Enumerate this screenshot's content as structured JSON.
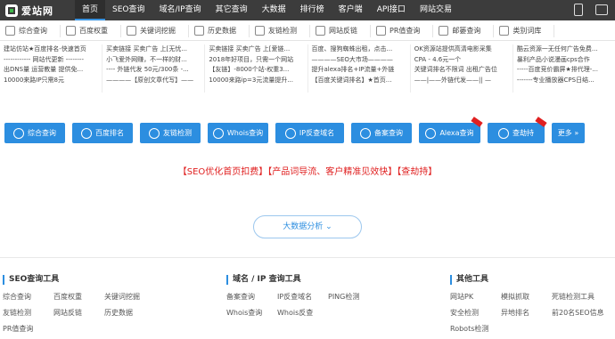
{
  "header": {
    "logo_text": "爱站网",
    "nav": [
      "首页",
      "SEO查询",
      "域名/IP查询",
      "其它查询",
      "大数据",
      "排行榜",
      "客户端",
      "API接口",
      "网站交易"
    ],
    "active_nav": 0
  },
  "toolbar": {
    "items": [
      {
        "label": "综合查询",
        "icon": "search-icon"
      },
      {
        "label": "百度权重",
        "icon": "paw-icon"
      },
      {
        "label": "关键词挖掘",
        "icon": "keyword-icon"
      },
      {
        "label": "历史数据",
        "icon": "history-icon"
      },
      {
        "label": "友链检测",
        "icon": "link-icon"
      },
      {
        "label": "网站反链",
        "icon": "backlink-icon"
      },
      {
        "label": "PR值查询",
        "icon": "pr-icon"
      },
      {
        "label": "邮篓查询",
        "icon": "mail-icon"
      },
      {
        "label": "类别词库",
        "icon": "category-icon"
      }
    ]
  },
  "ads": [
    [
      "建站仿站★百度排名-快速首页",
      "------------ 网站代更新 --------",
      "出DNS量 运营教量 提供免...",
      "10000来路IP只需8元"
    ],
    [
      "买卖链接 买卖广告 上[无忧...",
      "小飞爱外网赚，不一样的财...",
      "---- 外链代发 50元/300条 -...",
      "————【原创文章代写】——"
    ],
    [
      "买卖链接 买卖广告 上[爱链...",
      "2018年好项目，只需一个网站",
      "【友链】-8000个站-权重3...",
      "10000来路ip=3元流量提升..."
    ],
    [
      "百度、搜狗蜘蛛出租，点击...",
      "————SEO大市场————",
      "提升alexa排名+IP流量+外链",
      "【百度关键词排名】★首页..."
    ],
    [
      "OK资源站提供高清电影采集",
      "CPA - 4.6元一个",
      "关键词排名不限词 出租广告位",
      "——|——外链代发——|| —"
    ],
    [
      "酷云资源一无任何广告免费...",
      "暴利产品小说漫画cps合作",
      "-----百度竞价霸屏★排代理-...",
      "-------专业播放器CPS日结..."
    ]
  ],
  "big_buttons": [
    {
      "label": "综合查询",
      "icon": "globe-icon",
      "hot": false
    },
    {
      "label": "百度排名",
      "icon": "paw-icon",
      "hot": false
    },
    {
      "label": "友链检测",
      "icon": "link-icon",
      "hot": false
    },
    {
      "label": "Whois查询",
      "icon": "whois-icon",
      "hot": false
    },
    {
      "label": "IP反查域名",
      "icon": "ip-icon",
      "hot": false
    },
    {
      "label": "备案查询",
      "icon": "record-icon",
      "hot": false
    },
    {
      "label": "Alexa查询",
      "icon": "alexa-icon",
      "hot": true
    },
    {
      "label": "查劫持",
      "icon": "camera-icon",
      "hot": true
    },
    {
      "label": "更多 »",
      "icon": "",
      "hot": false
    }
  ],
  "promo": "【SEO优化首页扣费】【产品词导流、客户精准见效快】【查劫持】",
  "more_data_label": "大数据分析 ⌄",
  "sections": [
    {
      "title": "SEO查询工具",
      "items": [
        "综合查询",
        "百度权重",
        "关键词挖掘",
        "友链检测",
        "网站反链",
        "历史数据",
        "PR值查询"
      ]
    },
    {
      "title": "域名 / IP 查询工具",
      "items": [
        "备案查询",
        "IP反查域名",
        "PING检测",
        "Whois查询",
        "Whois反查"
      ]
    },
    {
      "title": "其他工具",
      "items": [
        "网站PK",
        "模拟抓取",
        "死链检测工具",
        "安全检测",
        "异地排名",
        "前20名SEO信息",
        "Robots检测"
      ]
    }
  ],
  "colors": {
    "nav_bg": "#3c3c3c",
    "accent": "#2c8ee0",
    "promo": "#e02020"
  }
}
